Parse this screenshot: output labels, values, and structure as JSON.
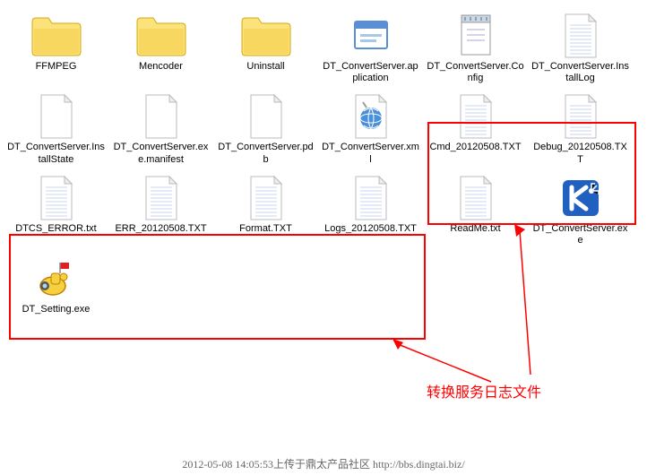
{
  "files": [
    {
      "name": "FFMPEG",
      "icon": "folder"
    },
    {
      "name": "Mencoder",
      "icon": "folder"
    },
    {
      "name": "Uninstall",
      "icon": "folder"
    },
    {
      "name": "DT_ConvertServer.application",
      "icon": "app"
    },
    {
      "name": "DT_ConvertServer.Config",
      "icon": "notepad"
    },
    {
      "name": "DT_ConvertServer.InstallLog",
      "icon": "text"
    },
    {
      "name": "DT_ConvertServer.InstallState",
      "icon": "blank"
    },
    {
      "name": "DT_ConvertServer.exe.manifest",
      "icon": "blank"
    },
    {
      "name": "DT_ConvertServer.pdb",
      "icon": "blank"
    },
    {
      "name": "DT_ConvertServer.xml",
      "icon": "xml"
    },
    {
      "name": "Cmd_20120508.TXT",
      "icon": "text"
    },
    {
      "name": "Debug_20120508.TXT",
      "icon": "text"
    },
    {
      "name": "DTCS_ERROR.txt",
      "icon": "text"
    },
    {
      "name": "ERR_20120508.TXT",
      "icon": "text"
    },
    {
      "name": "Format.TXT",
      "icon": "text"
    },
    {
      "name": "Logs_20120508.TXT",
      "icon": "text"
    },
    {
      "name": "ReadMe.txt",
      "icon": "text"
    },
    {
      "name": "DT_ConvertServer.exe",
      "icon": "kexe"
    },
    {
      "name": "DT_Setting.exe",
      "icon": "setting"
    }
  ],
  "annotation": "转换服务日志文件",
  "footer": "2012-05-08 14:05:53上传于鼎太产品社区 http://bbs.dingtai.biz/"
}
